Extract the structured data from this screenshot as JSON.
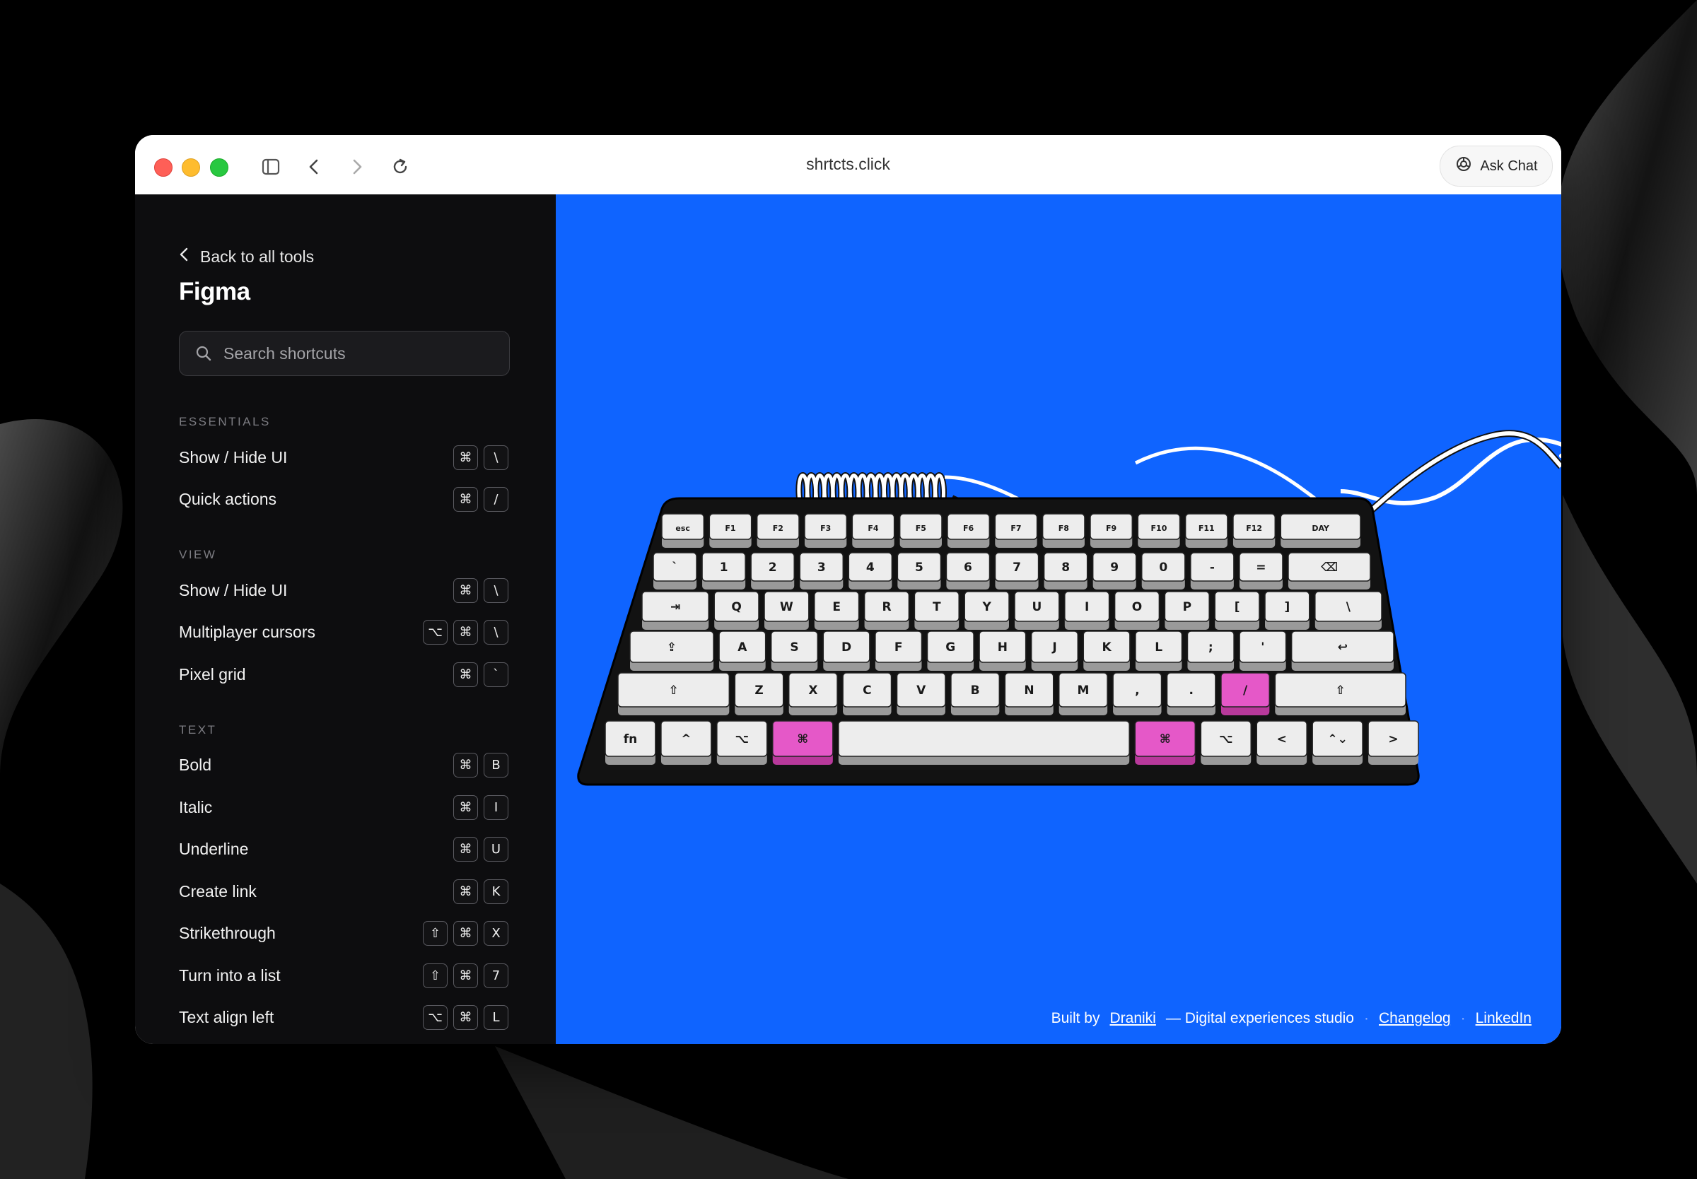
{
  "browser": {
    "url": "shrtcts.click",
    "ask_chat_label": "Ask Chat"
  },
  "sidebar": {
    "back_label": "Back to all tools",
    "title": "Figma",
    "search_placeholder": "Search shortcuts",
    "sections": [
      {
        "label": "ESSENTIALS",
        "items": [
          {
            "label": "Show / Hide UI",
            "keys": [
              "⌘",
              "\\"
            ]
          },
          {
            "label": "Quick actions",
            "keys": [
              "⌘",
              "/"
            ]
          }
        ]
      },
      {
        "label": "VIEW",
        "items": [
          {
            "label": "Show / Hide UI",
            "keys": [
              "⌘",
              "\\"
            ]
          },
          {
            "label": "Multiplayer cursors",
            "keys": [
              "⌥",
              "⌘",
              "\\"
            ]
          },
          {
            "label": "Pixel grid",
            "keys": [
              "⌘",
              "`"
            ]
          }
        ]
      },
      {
        "label": "TEXT",
        "items": [
          {
            "label": "Bold",
            "keys": [
              "⌘",
              "B"
            ]
          },
          {
            "label": "Italic",
            "keys": [
              "⌘",
              "I"
            ]
          },
          {
            "label": "Underline",
            "keys": [
              "⌘",
              "U"
            ]
          },
          {
            "label": "Create link",
            "keys": [
              "⌘",
              "K"
            ]
          },
          {
            "label": "Strikethrough",
            "keys": [
              "⇧",
              "⌘",
              "X"
            ]
          },
          {
            "label": "Turn into a list",
            "keys": [
              "⇧",
              "⌘",
              "7"
            ]
          },
          {
            "label": "Text align left",
            "keys": [
              "⌥",
              "⌘",
              "L"
            ]
          }
        ]
      }
    ]
  },
  "keyboard": {
    "rows": [
      [
        "esc",
        "F1",
        "F2",
        "F3",
        "F4",
        "F5",
        "F6",
        "F7",
        "F8",
        "F9",
        "F10",
        "F11",
        "F12",
        "DAY"
      ],
      [
        "`",
        "1",
        "2",
        "3",
        "4",
        "5",
        "6",
        "7",
        "8",
        "9",
        "0",
        "-",
        "=",
        "⌫"
      ],
      [
        "⇥",
        "Q",
        "W",
        "E",
        "R",
        "T",
        "Y",
        "U",
        "I",
        "O",
        "P",
        "[",
        "]",
        "\\"
      ],
      [
        "⇪",
        "A",
        "S",
        "D",
        "F",
        "G",
        "H",
        "J",
        "K",
        "L",
        ";",
        "'",
        "↩"
      ],
      [
        "⇧",
        "Z",
        "X",
        "C",
        "V",
        "B",
        "N",
        "M",
        ",",
        ".",
        "/",
        "⇧"
      ],
      [
        "fn",
        "^",
        "⌥",
        "⌘",
        "",
        "⌘",
        "⌥",
        "<",
        "⌃⌄",
        ">"
      ]
    ],
    "highlighted_keys": [
      "⌘ (left)",
      "⌘ (right)",
      "/"
    ],
    "highlight_color": "#e558c8",
    "key_color": "#ededed",
    "base_color": "#111111"
  },
  "footer": {
    "built_by": "Built by",
    "studio_link": "Draniki",
    "studio_desc": "— Digital experiences studio",
    "sep": "·",
    "changelog": "Changelog",
    "linkedin": "LinkedIn"
  },
  "colors": {
    "main_bg": "#0f64ff",
    "sidebar_bg": "#0d0d0f"
  }
}
